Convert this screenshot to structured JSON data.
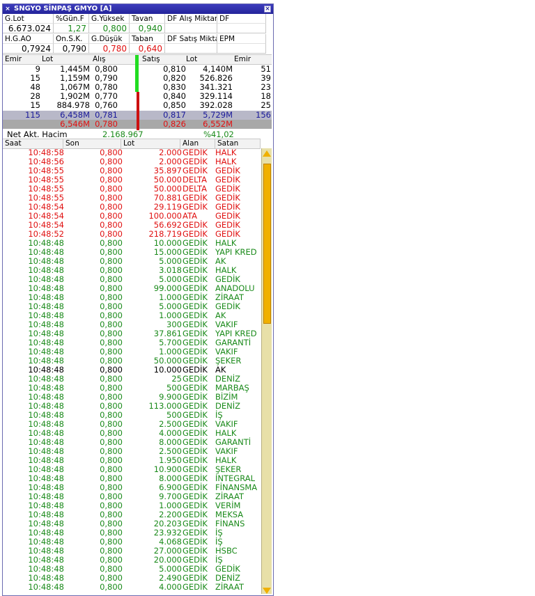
{
  "window": {
    "title": "SNGYO SİNPAŞ GMYO [A]"
  },
  "summary": {
    "row1": [
      {
        "label": "G.Lot",
        "value": "6.673.024",
        "color": "black"
      },
      {
        "label": "%Gün.F",
        "value": "1,27",
        "color": "green"
      },
      {
        "label": "G.Yüksek",
        "value": "0,800",
        "color": "green"
      },
      {
        "label": "Tavan",
        "value": "0,940",
        "color": "green"
      },
      {
        "label": "DF Alış Miktar",
        "value": "",
        "color": "black"
      },
      {
        "label": "DF",
        "value": "",
        "color": "black"
      }
    ],
    "row2": [
      {
        "label": "H.G.AO",
        "value": "0,7924",
        "color": "black"
      },
      {
        "label": "On.S.K.",
        "value": "0,790",
        "color": "black"
      },
      {
        "label": "G.Düşük",
        "value": "0,780",
        "color": "red"
      },
      {
        "label": "Taban",
        "value": "0,640",
        "color": "red"
      },
      {
        "label": "DF Satış Mikta",
        "value": "",
        "color": "black"
      },
      {
        "label": "EPM",
        "value": "",
        "color": "black"
      }
    ]
  },
  "book": {
    "headers": [
      "Emir",
      "Lot",
      "Alış",
      "Satış",
      "Lot",
      "Emir"
    ],
    "rows": [
      [
        "9",
        "1,445M",
        "0,800",
        "0,810",
        "4,140M",
        "51"
      ],
      [
        "15",
        "1,159M",
        "0,790",
        "0,820",
        "526.826",
        "39"
      ],
      [
        "48",
        "1,067M",
        "0,780",
        "0,830",
        "341.321",
        "23"
      ],
      [
        "28",
        "1,902M",
        "0,770",
        "0,840",
        "329.114",
        "18"
      ],
      [
        "15",
        "884.978",
        "0,760",
        "0,850",
        "392.028",
        "25"
      ]
    ],
    "total_row": [
      "115",
      "6,458M",
      "0,781",
      "0,817",
      "5,729M",
      "156"
    ],
    "total_row2": [
      "",
      "6,546M",
      "0,780",
      "0,826",
      "6,552M",
      ""
    ]
  },
  "net": {
    "label": "Net Akt. Hacim",
    "value": "2.168.967",
    "pct": "%41,02"
  },
  "trades": {
    "headers": [
      "Saat",
      "Son",
      "Lot",
      "Alan",
      "Satan"
    ],
    "rows": [
      [
        "10:48:58",
        "0,800",
        "2.000",
        "GEDİK",
        "HALK",
        "red"
      ],
      [
        "10:48:56",
        "0,800",
        "2.000",
        "GEDİK",
        "HALK",
        "red"
      ],
      [
        "10:48:55",
        "0,800",
        "35.897",
        "GEDİK",
        "GEDİK",
        "red"
      ],
      [
        "10:48:55",
        "0,800",
        "50.000",
        "DELTA",
        "GEDİK",
        "red"
      ],
      [
        "10:48:55",
        "0,800",
        "50.000",
        "DELTA",
        "GEDİK",
        "red"
      ],
      [
        "10:48:55",
        "0,800",
        "70.881",
        "GEDİK",
        "GEDİK",
        "red"
      ],
      [
        "10:48:54",
        "0,800",
        "29.119",
        "GEDİK",
        "GEDİK",
        "red"
      ],
      [
        "10:48:54",
        "0,800",
        "100.000",
        "ATA",
        "GEDİK",
        "red"
      ],
      [
        "10:48:54",
        "0,800",
        "56.692",
        "GEDİK",
        "GEDİK",
        "red"
      ],
      [
        "10:48:52",
        "0,800",
        "218.719",
        "GEDİK",
        "GEDİK",
        "red"
      ],
      [
        "10:48:48",
        "0,800",
        "10.000",
        "GEDİK",
        "HALK",
        "green"
      ],
      [
        "10:48:48",
        "0,800",
        "15.000",
        "GEDİK",
        "YAPI KRED",
        "green"
      ],
      [
        "10:48:48",
        "0,800",
        "5.000",
        "GEDİK",
        "AK",
        "green"
      ],
      [
        "10:48:48",
        "0,800",
        "3.018",
        "GEDİK",
        "HALK",
        "green"
      ],
      [
        "10:48:48",
        "0,800",
        "5.000",
        "GEDİK",
        "GEDİK",
        "green"
      ],
      [
        "10:48:48",
        "0,800",
        "99.000",
        "GEDİK",
        "ANADOLU",
        "green"
      ],
      [
        "10:48:48",
        "0,800",
        "1.000",
        "GEDİK",
        "ZİRAAT",
        "green"
      ],
      [
        "10:48:48",
        "0,800",
        "5.000",
        "GEDİK",
        "GEDİK",
        "green"
      ],
      [
        "10:48:48",
        "0,800",
        "1.000",
        "GEDİK",
        "AK",
        "green"
      ],
      [
        "10:48:48",
        "0,800",
        "300",
        "GEDİK",
        "VAKIF",
        "green"
      ],
      [
        "10:48:48",
        "0,800",
        "37.861",
        "GEDİK",
        "YAPI KRED",
        "green"
      ],
      [
        "10:48:48",
        "0,800",
        "5.700",
        "GEDİK",
        "GARANTİ",
        "green"
      ],
      [
        "10:48:48",
        "0,800",
        "1.000",
        "GEDİK",
        "VAKIF",
        "green"
      ],
      [
        "10:48:48",
        "0,800",
        "50.000",
        "GEDİK",
        "ŞEKER",
        "green"
      ],
      [
        "10:48:48",
        "0,800",
        "10.000",
        "GEDİK",
        "AK",
        "black"
      ],
      [
        "10:48:48",
        "0,800",
        "25",
        "GEDİK",
        "DENİZ",
        "green"
      ],
      [
        "10:48:48",
        "0,800",
        "500",
        "GEDİK",
        "MARBAŞ",
        "green"
      ],
      [
        "10:48:48",
        "0,800",
        "9.900",
        "GEDİK",
        "BİZİM",
        "green"
      ],
      [
        "10:48:48",
        "0,800",
        "113.000",
        "GEDİK",
        "DENİZ",
        "green"
      ],
      [
        "10:48:48",
        "0,800",
        "500",
        "GEDİK",
        "İŞ",
        "green"
      ],
      [
        "10:48:48",
        "0,800",
        "2.500",
        "GEDİK",
        "VAKIF",
        "green"
      ],
      [
        "10:48:48",
        "0,800",
        "4.000",
        "GEDİK",
        "HALK",
        "green"
      ],
      [
        "10:48:48",
        "0,800",
        "8.000",
        "GEDİK",
        "GARANTİ",
        "green"
      ],
      [
        "10:48:48",
        "0,800",
        "2.500",
        "GEDİK",
        "VAKIF",
        "green"
      ],
      [
        "10:48:48",
        "0,800",
        "1.950",
        "GEDİK",
        "HALK",
        "green"
      ],
      [
        "10:48:48",
        "0,800",
        "10.900",
        "GEDİK",
        "ŞEKER",
        "green"
      ],
      [
        "10:48:48",
        "0,800",
        "8.000",
        "GEDİK",
        "İNTEGRAL",
        "green"
      ],
      [
        "10:48:48",
        "0,800",
        "6.900",
        "GEDİK",
        "FİNANSMA",
        "green"
      ],
      [
        "10:48:48",
        "0,800",
        "9.700",
        "GEDİK",
        "ZİRAAT",
        "green"
      ],
      [
        "10:48:48",
        "0,800",
        "1.000",
        "GEDİK",
        "VERİM",
        "green"
      ],
      [
        "10:48:48",
        "0,800",
        "2.200",
        "GEDİK",
        "MEKSA",
        "green"
      ],
      [
        "10:48:48",
        "0,800",
        "20.203",
        "GEDİK",
        "FİNANS",
        "green"
      ],
      [
        "10:48:48",
        "0,800",
        "23.932",
        "GEDİK",
        "İŞ",
        "green"
      ],
      [
        "10:48:48",
        "0,800",
        "4.068",
        "GEDİK",
        "İŞ",
        "green"
      ],
      [
        "10:48:48",
        "0,800",
        "27.000",
        "GEDİK",
        "HSBC",
        "green"
      ],
      [
        "10:48:48",
        "0,800",
        "20.000",
        "GEDİK",
        "İŞ",
        "green"
      ],
      [
        "10:48:48",
        "0,800",
        "5.000",
        "GEDİK",
        "GEDİK",
        "green"
      ],
      [
        "10:48:48",
        "0,800",
        "2.490",
        "GEDİK",
        "DENİZ",
        "green"
      ],
      [
        "10:48:48",
        "0,800",
        "4.000",
        "GEDİK",
        "ZİRAAT",
        "green"
      ]
    ]
  },
  "colors": {
    "green": "#1a8a1a",
    "red": "#e01010",
    "blue": "#1a1a9a",
    "black": "#000000",
    "titlebar": "#2a2aa8"
  }
}
